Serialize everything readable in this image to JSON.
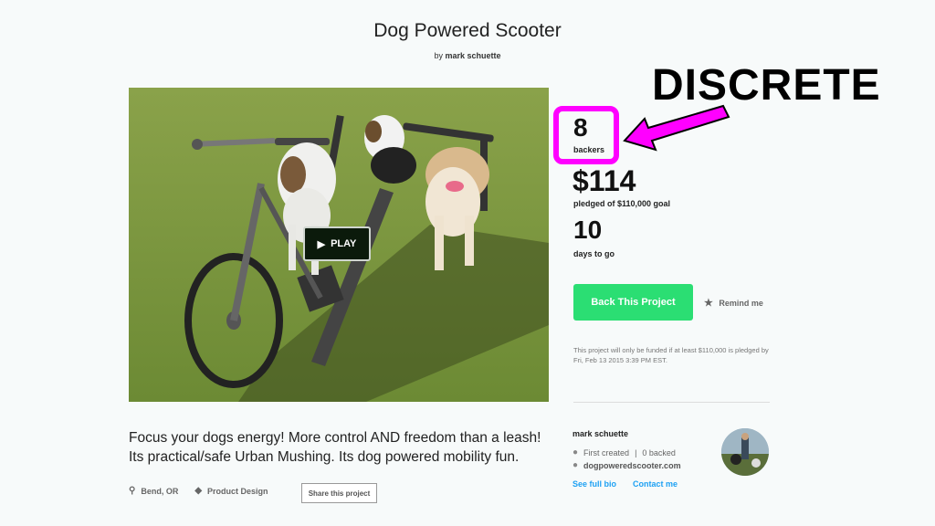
{
  "project": {
    "title": "Dog Powered Scooter",
    "by_prefix": "by",
    "creator": "mark schuette"
  },
  "video": {
    "play_label": "PLAY"
  },
  "stats": {
    "backers_count": "8",
    "backers_label": "backers",
    "pledged_amount": "$114",
    "pledged_label": "pledged of $110,000 goal",
    "days_count": "10",
    "days_label": "days to go"
  },
  "actions": {
    "back_label": "Back This Project",
    "remind_label": "Remind me"
  },
  "funding_note": "This project will only be funded if at least $110,000 is pledged by Fri, Feb 13 2015 3:39 PM EST.",
  "creator_card": {
    "name": "mark schuette",
    "first_created": "First created",
    "backed": "0 backed",
    "website": "dogpoweredscooter.com",
    "bio_link": "See full bio",
    "contact_link": "Contact me"
  },
  "blurb": "Focus your dogs energy! More control AND freedom than a leash! Its practical/safe Urban Mushing. Its dog powered mobility fun.",
  "tags": {
    "location": "Bend, OR",
    "category": "Product Design"
  },
  "share_label": "Share this project",
  "annotation": {
    "text": "DISCRETE",
    "color": "#ff00ff"
  },
  "colors": {
    "back_button": "#2bde73",
    "link": "#1ea1f3",
    "highlight": "#ff00ff"
  }
}
